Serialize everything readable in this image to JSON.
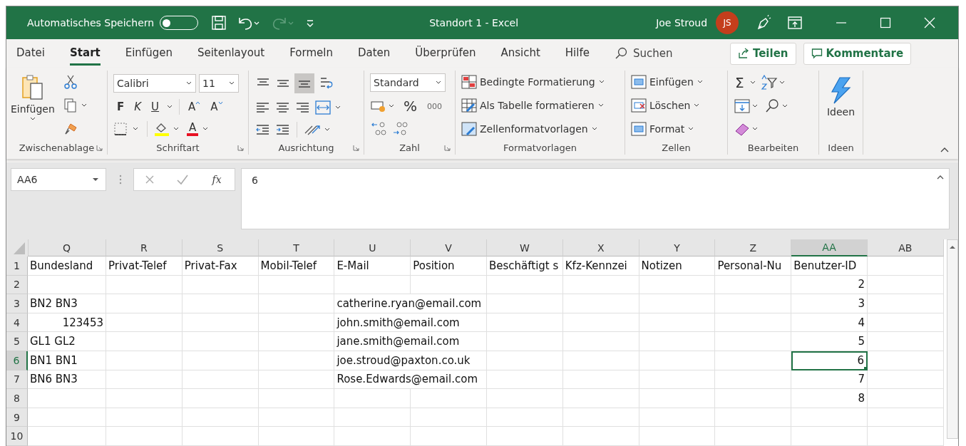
{
  "title_bar": {
    "autosave_label": "Automatisches Speichern",
    "autosave_on": false,
    "title": "Standort 1 - Excel",
    "user": "Joe Stroud",
    "avatar_initials": "JS"
  },
  "menu_tabs": [
    {
      "label": "Datei",
      "selected": false
    },
    {
      "label": "Start",
      "selected": true
    },
    {
      "label": "Einfügen",
      "selected": false
    },
    {
      "label": "Seitenlayout",
      "selected": false
    },
    {
      "label": "Formeln",
      "selected": false
    },
    {
      "label": "Daten",
      "selected": false
    },
    {
      "label": "Überprüfen",
      "selected": false
    },
    {
      "label": "Ansicht",
      "selected": false
    },
    {
      "label": "Hilfe",
      "selected": false
    }
  ],
  "search": {
    "placeholder": "Suchen"
  },
  "share_button": "Teilen",
  "comments_button": "Kommentare",
  "ribbon": {
    "clipboard": {
      "paste": "Einfügen",
      "label": "Zwischenablage"
    },
    "font": {
      "family": "Calibri",
      "size": "11",
      "bold": "F",
      "italic": "K",
      "underline": "U",
      "grow": "A",
      "shrink": "A",
      "font_color_letter": "A",
      "label": "Schriftart"
    },
    "alignment": {
      "label": "Ausrichtung"
    },
    "number": {
      "format": "Standard",
      "percent": "%",
      "thousands": "000",
      "label": "Zahl"
    },
    "styles": {
      "items": [
        "Bedingte Formatierung",
        "Als Tabelle formatieren",
        "Zellenformatvorlagen"
      ],
      "label": "Formatvorlagen"
    },
    "cells": {
      "items": [
        "Einfügen",
        "Löschen",
        "Format"
      ],
      "label": "Zellen"
    },
    "editing": {
      "sum": "Σ",
      "label": "Bearbeiten"
    },
    "ideas": {
      "button": "Ideen",
      "label": "Ideen"
    }
  },
  "formula_bar": {
    "name_box": "AA6",
    "fx": "fx",
    "value": "6"
  },
  "columns": [
    {
      "label": "Q",
      "selected": false
    },
    {
      "label": "R",
      "selected": false
    },
    {
      "label": "S",
      "selected": false
    },
    {
      "label": "T",
      "selected": false
    },
    {
      "label": "U",
      "selected": false
    },
    {
      "label": "V",
      "selected": false
    },
    {
      "label": "W",
      "selected": false
    },
    {
      "label": "X",
      "selected": false
    },
    {
      "label": "Y",
      "selected": false
    },
    {
      "label": "Z",
      "selected": false
    },
    {
      "label": "AA",
      "selected": true
    },
    {
      "label": "AB",
      "selected": false
    }
  ],
  "rows": [
    {
      "number": "1",
      "selected": false,
      "bundesland": {
        "text": "Bundesland",
        "numeric": false
      },
      "privat_telefon": {
        "text": "Privat-Telef",
        "numeric": false
      },
      "privat_fax": {
        "text": "Privat-Fax",
        "numeric": false
      },
      "mobil_telefon": {
        "text": "Mobil-Telef",
        "numeric": false
      },
      "email": {
        "text": "E-Mail",
        "numeric": false
      },
      "position": {
        "text": "Position",
        "numeric": false
      },
      "beschaeftigt": {
        "text": "Beschäftigt s",
        "numeric": false
      },
      "kfz": {
        "text": "Kfz-Kennzei",
        "numeric": false
      },
      "notizen": {
        "text": "Notizen",
        "numeric": false
      },
      "personal_nr": {
        "text": "Personal-Nu",
        "numeric": false
      },
      "benutzer_id": {
        "text": "Benutzer-ID",
        "numeric": false
      }
    },
    {
      "number": "2",
      "selected": false,
      "benutzer_id": {
        "text": "2",
        "numeric": true
      }
    },
    {
      "number": "3",
      "selected": false,
      "bundesland": {
        "text": "BN2 BN3",
        "numeric": false
      },
      "email": {
        "text": "catherine.ryan@email.com",
        "numeric": false
      },
      "benutzer_id": {
        "text": "3",
        "numeric": true
      }
    },
    {
      "number": "4",
      "selected": false,
      "bundesland": {
        "text": "123453",
        "numeric": true
      },
      "email": {
        "text": "john.smith@email.com",
        "numeric": false
      },
      "benutzer_id": {
        "text": "4",
        "numeric": true
      }
    },
    {
      "number": "5",
      "selected": false,
      "bundesland": {
        "text": "GL1 GL2",
        "numeric": false
      },
      "email": {
        "text": "jane.smith@email.com",
        "numeric": false
      },
      "benutzer_id": {
        "text": "5",
        "numeric": true
      }
    },
    {
      "number": "6",
      "selected": true,
      "bundesland": {
        "text": "BN1 BN1",
        "numeric": false
      },
      "email": {
        "text": "joe.stroud@paxton.co.uk",
        "numeric": false
      },
      "benutzer_id": {
        "text": "6",
        "numeric": true
      }
    },
    {
      "number": "7",
      "selected": false,
      "bundesland": {
        "text": "BN6 BN3",
        "numeric": false
      },
      "email": {
        "text": "Rose.Edwards@email.com",
        "numeric": false
      },
      "benutzer_id": {
        "text": "7",
        "numeric": true
      }
    },
    {
      "number": "8",
      "selected": false,
      "benutzer_id": {
        "text": "8",
        "numeric": true
      }
    },
    {
      "number": "9",
      "selected": false
    },
    {
      "number": "10",
      "selected": false
    }
  ]
}
